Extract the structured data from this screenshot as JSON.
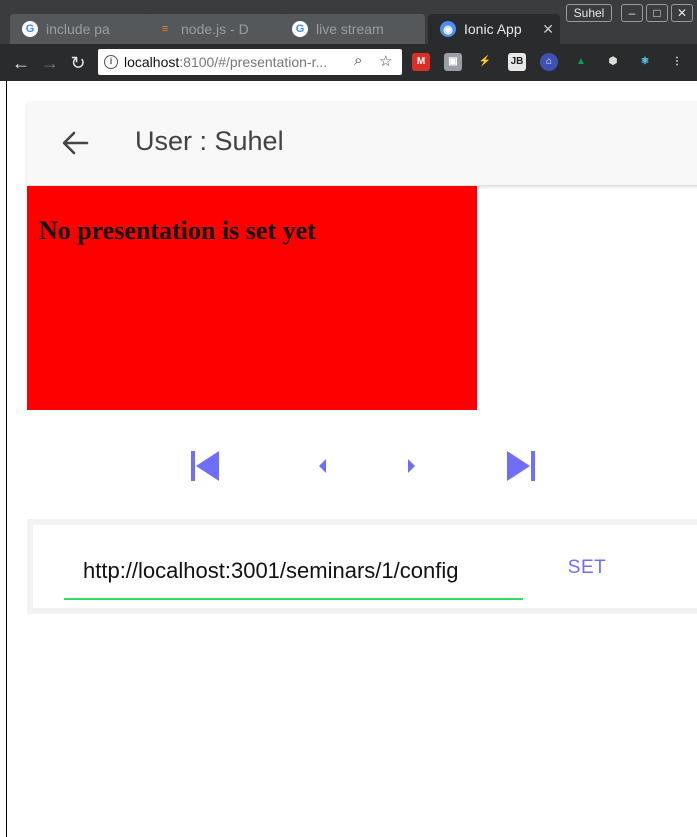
{
  "browser": {
    "tabs": [
      {
        "title": "include pa",
        "favicon": "google-icon"
      },
      {
        "title": "node.js - D",
        "favicon": "stackoverflow-icon"
      },
      {
        "title": "live stream",
        "favicon": "google-icon"
      },
      {
        "title": "Ionic App",
        "favicon": "ionic-icon"
      }
    ],
    "user": "Suhel",
    "url_host": "localhost",
    "url_rest": ":8100/#/presentation-r..."
  },
  "header": {
    "title": "User : Suhel"
  },
  "presentation": {
    "message": "No presentation is set yet",
    "background": "#ff0000"
  },
  "controls": [
    "first-slide-icon",
    "previous-slide-icon",
    "next-slide-icon",
    "last-slide-icon"
  ],
  "form": {
    "url_value": "http://localhost:3001/seminars/1/config",
    "set_label": "SET"
  },
  "colors": {
    "accent": "#6e6efa",
    "input_underline": "#32db64"
  }
}
